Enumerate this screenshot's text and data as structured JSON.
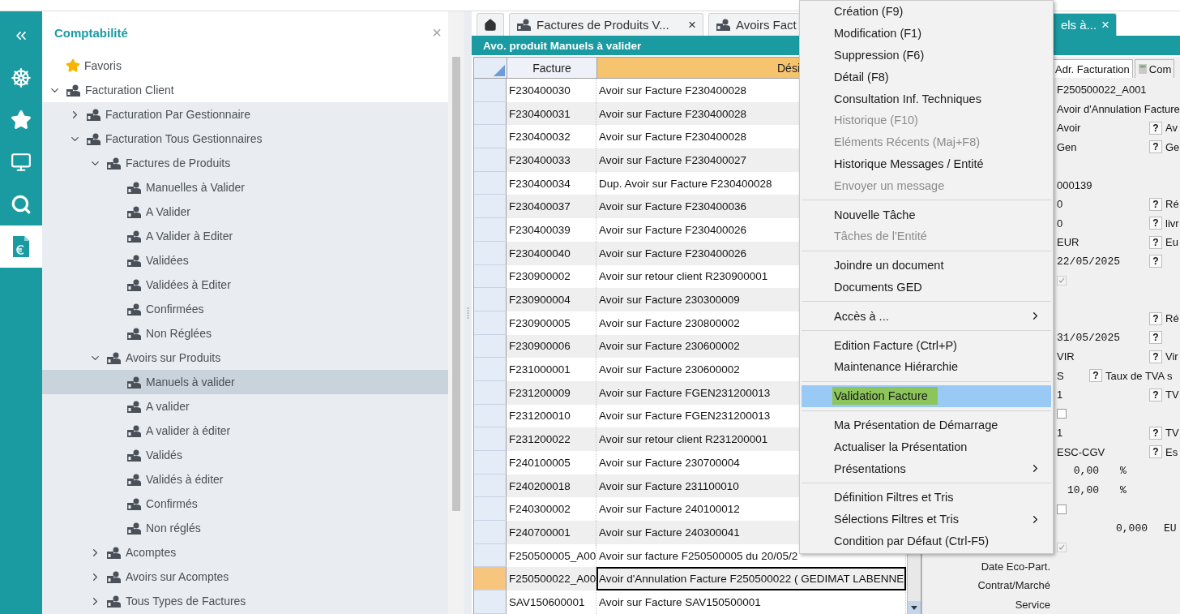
{
  "rail": [
    {
      "kind": "collapse",
      "selected": false
    },
    {
      "kind": "wheel",
      "selected": false
    },
    {
      "kind": "star",
      "selected": false
    },
    {
      "kind": "monitor",
      "selected": false
    },
    {
      "kind": "search",
      "selected": false
    },
    {
      "kind": "invoice",
      "selected": true
    }
  ],
  "sidebar": {
    "title": "Comptabilité",
    "close": "×",
    "tree": [
      {
        "label": "Favoris",
        "kind": "favorite",
        "selected": false
      },
      {
        "label": "Facturation Client",
        "selected": false,
        "expanded": true,
        "children": [
          {
            "label": "Facturation Par Gestionnaire",
            "selected": false,
            "expanded": false
          },
          {
            "label": "Facturation Tous Gestionnaires",
            "selected": false,
            "expanded": true,
            "children": [
              {
                "label": "Factures de Produits",
                "selected": false,
                "expanded": true,
                "children": [
                  {
                    "label": "Manuelles à Valider",
                    "selected": false
                  },
                  {
                    "label": "A Valider",
                    "selected": false
                  },
                  {
                    "label": "A Valider à Editer",
                    "selected": false
                  },
                  {
                    "label": "Validées",
                    "selected": false
                  },
                  {
                    "label": "Validées à Editer",
                    "selected": false
                  },
                  {
                    "label": "Confirmées",
                    "selected": false
                  },
                  {
                    "label": "Non Réglées",
                    "selected": false
                  }
                ]
              },
              {
                "label": "Avoirs sur Produits",
                "selected": false,
                "expanded": true,
                "children": [
                  {
                    "label": "Manuels à valider",
                    "selected": true
                  },
                  {
                    "label": "A valider",
                    "selected": false
                  },
                  {
                    "label": "A valider à éditer",
                    "selected": false
                  },
                  {
                    "label": "Validés",
                    "selected": false
                  },
                  {
                    "label": "Validés à éditer",
                    "selected": false
                  },
                  {
                    "label": "Confirmés",
                    "selected": false
                  },
                  {
                    "label": "Non réglés",
                    "selected": false
                  }
                ]
              },
              {
                "label": "Acomptes",
                "selected": false,
                "expanded": false
              },
              {
                "label": "Avoirs sur Acomptes",
                "selected": false,
                "expanded": false
              },
              {
                "label": "Tous Types de Factures",
                "selected": false,
                "expanded": false
              }
            ]
          }
        ]
      }
    ]
  },
  "tabs": [
    {
      "kind": "home",
      "selected": false
    },
    {
      "label": "Factures de Produits V...",
      "close": "×",
      "selected": false
    },
    {
      "label": "Avoirs Fact",
      "selected": false
    },
    {
      "label": "els à...",
      "close": "×",
      "selected": true
    }
  ],
  "view_title": "Avo. produit Manuels à valider",
  "table": {
    "columns": [
      "Facture",
      "Dési"
    ],
    "rows": [
      {
        "facture": "F230400030",
        "designation": "Avoir sur Facture F230400028",
        "selected": false
      },
      {
        "facture": "F230400031",
        "designation": "Avoir sur Facture F230400028",
        "selected": false
      },
      {
        "facture": "F230400032",
        "designation": "Avoir sur Facture F230400028",
        "selected": false
      },
      {
        "facture": "F230400033",
        "designation": "Avoir sur Facture F230400027",
        "selected": false
      },
      {
        "facture": "F230400034",
        "designation": "Dup. Avoir sur Facture F230400028",
        "selected": false
      },
      {
        "facture": "F230400037",
        "designation": "Avoir sur Facture F230400036",
        "selected": false
      },
      {
        "facture": "F230400039",
        "designation": "Avoir sur Facture F230400026",
        "selected": false
      },
      {
        "facture": "F230400040",
        "designation": "Avoir sur Facture F230400026",
        "selected": false
      },
      {
        "facture": "F230900002",
        "designation": "Avoir sur retour client R230900001",
        "selected": false
      },
      {
        "facture": "F230900004",
        "designation": "Avoir sur Facture 230300009",
        "selected": false
      },
      {
        "facture": "F230900005",
        "designation": "Avoir sur Facture 230800002",
        "selected": false
      },
      {
        "facture": "F230900006",
        "designation": "Avoir sur Facture 230600002",
        "selected": false
      },
      {
        "facture": "F231000001",
        "designation": "Avoir sur Facture 230600002",
        "selected": false
      },
      {
        "facture": "F231200009",
        "designation": "Avoir sur Facture FGEN231200013",
        "selected": false
      },
      {
        "facture": "F231200010",
        "designation": "Avoir sur Facture FGEN231200013",
        "selected": false
      },
      {
        "facture": "F231200022",
        "designation": "Avoir sur retour client R231200001",
        "selected": false
      },
      {
        "facture": "F240100005",
        "designation": "Avoir sur Facture 230700004",
        "selected": false
      },
      {
        "facture": "F240200018",
        "designation": "Avoir sur Facture 231100010",
        "selected": false
      },
      {
        "facture": "F240300002",
        "designation": "Avoir sur Facture 240100012",
        "selected": false
      },
      {
        "facture": "F240700001",
        "designation": "Avoir sur Facture 240300041",
        "selected": false
      },
      {
        "facture": "F250500005_A00",
        "designation": "Avoir sur facture F250500005 du 20/05/2",
        "selected": false
      },
      {
        "facture": "F250500022_A00",
        "designation": "Avoir d'Annulation Facture F250500022 ( GEDIMAT LABENNE",
        "selected": true
      },
      {
        "facture": "SAV150600001",
        "designation": "Avoir sur Facture SAV150500001",
        "selected": false
      }
    ]
  },
  "detail": {
    "tabs": [
      {
        "label": "Adr. Facturation",
        "selected": true
      },
      {
        "label": "Com",
        "selected": false
      }
    ],
    "rows": [
      {
        "kind": "field",
        "value": "F250500022_A001"
      },
      {
        "kind": "field",
        "value": "Avoir d'Annulation Facture"
      },
      {
        "kind": "field",
        "value": "Avoir",
        "help": "?",
        "description": "Av"
      },
      {
        "kind": "field",
        "value": "Gen",
        "help": "?",
        "description": "Ge"
      },
      {
        "kind": "blank"
      },
      {
        "kind": "field",
        "value": "000139"
      },
      {
        "kind": "field",
        "value": "0",
        "help": "?",
        "description": "Ré"
      },
      {
        "kind": "field",
        "value": "0",
        "help": "?",
        "description": "livr"
      },
      {
        "kind": "field",
        "value": "EUR",
        "help": "?",
        "description": "Eu"
      },
      {
        "kind": "date",
        "value": "22/05/2025",
        "help": "?"
      },
      {
        "kind": "checkbox",
        "checked": true,
        "disabled": true
      },
      {
        "kind": "blank"
      },
      {
        "kind": "field",
        "help": "?",
        "description": "Ré"
      },
      {
        "kind": "date",
        "value": "31/05/2025",
        "help": "?"
      },
      {
        "kind": "field",
        "value": "VIR",
        "help": "?",
        "description": "Vir"
      },
      {
        "kind": "short",
        "value": "S",
        "help": "?",
        "description": "Taux de TVA s"
      },
      {
        "kind": "field",
        "value": "1",
        "help": "?",
        "description": "TV"
      },
      {
        "kind": "checkbox",
        "checked": false,
        "disabled": false
      },
      {
        "kind": "field",
        "value": "1",
        "help": "?",
        "description": "TV"
      },
      {
        "kind": "field",
        "value": "ESC-CGV",
        "help": "?",
        "description": "Es"
      },
      {
        "kind": "number",
        "value": "0,00",
        "unit": "%"
      },
      {
        "kind": "number",
        "value": "10,00",
        "unit": "%"
      },
      {
        "kind": "checkbox",
        "checked": false,
        "disabled": false
      },
      {
        "kind": "amount",
        "value": "0,000",
        "unit": "EU"
      },
      {
        "kind": "checkbox",
        "checked": true,
        "disabled": true
      },
      {
        "kind": "label",
        "label": "Date Eco-Part."
      },
      {
        "kind": "label",
        "label": "Contrat/Marché"
      },
      {
        "kind": "label",
        "label": "Service"
      }
    ]
  },
  "context_menu": [
    {
      "label": "Création (F9)",
      "disabled": false,
      "selected": false,
      "submenu": false
    },
    {
      "label": "Modification (F1)",
      "disabled": false,
      "selected": false,
      "submenu": false
    },
    {
      "label": "Suppression (F6)",
      "disabled": false,
      "selected": false,
      "submenu": false
    },
    {
      "label": "Détail (F8)",
      "disabled": false,
      "selected": false,
      "submenu": false
    },
    {
      "label": "Consultation Inf. Techniques",
      "disabled": false,
      "selected": false,
      "submenu": false
    },
    {
      "label": "Historique (F10)",
      "disabled": true,
      "selected": false,
      "submenu": false
    },
    {
      "label": "Eléments Récents (Maj+F8)",
      "disabled": true,
      "selected": false,
      "submenu": false
    },
    {
      "label": "Historique Messages / Entité",
      "disabled": false,
      "selected": false,
      "submenu": false
    },
    {
      "label": "Envoyer un message",
      "disabled": true,
      "selected": false,
      "submenu": false
    },
    {
      "kind": "separator"
    },
    {
      "label": "Nouvelle Tâche",
      "disabled": false,
      "selected": false,
      "submenu": false
    },
    {
      "label": "Tâches de l'Entité",
      "disabled": true,
      "selected": false,
      "submenu": false
    },
    {
      "kind": "separator"
    },
    {
      "label": "Joindre un document",
      "disabled": false,
      "selected": false,
      "submenu": false
    },
    {
      "label": "Documents GED",
      "disabled": false,
      "selected": false,
      "submenu": false
    },
    {
      "kind": "separator"
    },
    {
      "label": "Accès à ...",
      "disabled": false,
      "selected": false,
      "submenu": true
    },
    {
      "kind": "separator"
    },
    {
      "label": "Edition Facture (Ctrl+P)",
      "disabled": false,
      "selected": false,
      "submenu": false
    },
    {
      "label": "Maintenance Hiérarchie",
      "disabled": false,
      "selected": false,
      "submenu": false
    },
    {
      "kind": "separator"
    },
    {
      "label": "Validation Facture",
      "disabled": false,
      "selected": true,
      "submenu": false
    },
    {
      "kind": "separator"
    },
    {
      "label": "Ma Présentation de Démarrage",
      "disabled": false,
      "selected": false,
      "submenu": false
    },
    {
      "label": "Actualiser la Présentation",
      "disabled": false,
      "selected": false,
      "submenu": false
    },
    {
      "label": "Présentations",
      "disabled": false,
      "selected": false,
      "submenu": true
    },
    {
      "kind": "separator"
    },
    {
      "label": "Définition Filtres et Tris",
      "disabled": false,
      "selected": false,
      "submenu": false
    },
    {
      "label": "Sélections Filtres et Tris",
      "disabled": false,
      "selected": false,
      "submenu": true
    },
    {
      "label": "Condition par Défaut (Ctrl-F5)",
      "disabled": false,
      "selected": false,
      "submenu": false
    }
  ]
}
